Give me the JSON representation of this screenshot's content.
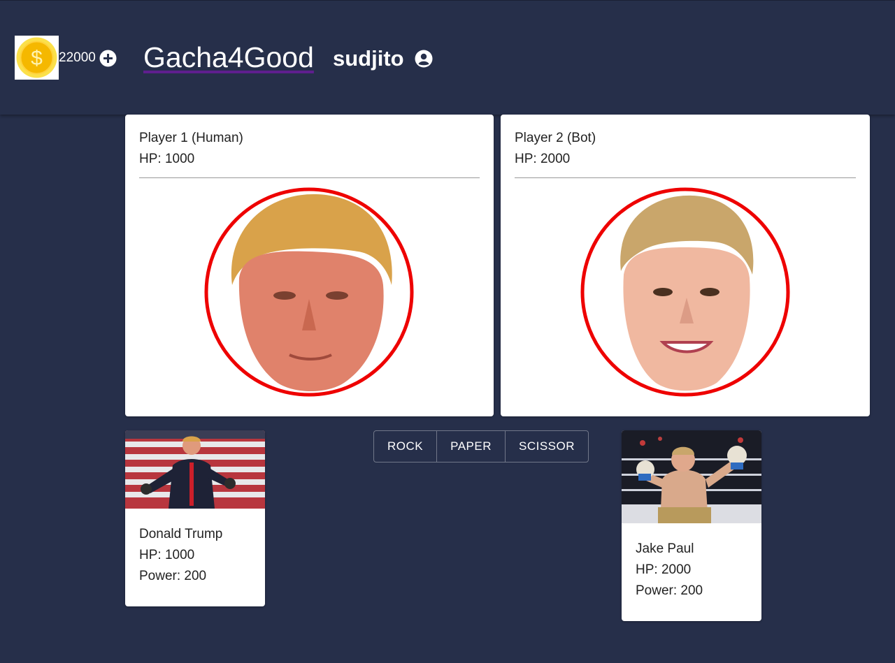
{
  "header": {
    "coin_count": "22000",
    "brand": "Gacha4Good",
    "username": "sudjito",
    "icons": {
      "coin": "dollar-coin-icon",
      "add": "plus-circle-icon",
      "user": "user-circle-icon"
    }
  },
  "players": [
    {
      "title": "Player 1 (Human)",
      "hp": "HP: 1000",
      "portrait": "trump-face"
    },
    {
      "title": "Player 2 (Bot)",
      "hp": "HP: 2000",
      "portrait": "jake-paul-face"
    }
  ],
  "moves": [
    "ROCK",
    "PAPER",
    "SCISSOR"
  ],
  "characters": [
    {
      "name": "Donald Trump",
      "hp": "HP: 1000",
      "power": "Power: 200"
    },
    {
      "name": "Jake Paul",
      "hp": "HP: 2000",
      "power": "Power: 200"
    }
  ],
  "colors": {
    "background": "#262f4a",
    "brand_underline": "#5e1f8e",
    "portrait_ring": "#ee0000",
    "coin": "#f5b800"
  }
}
